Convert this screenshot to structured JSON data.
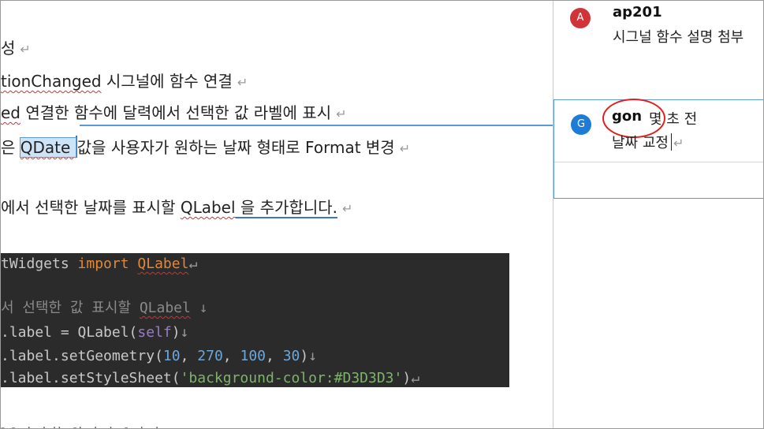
{
  "doc": {
    "line1": "성",
    "line2_code": "tionChanged",
    "line2_rest": " 시그널에 함수 연결",
    "line3_code": "ed",
    "line3_rest": " 연결한 함수에 달력에서 선택한 값 라벨에 표시",
    "line4_pre": "은 ",
    "line4_sel": "QDate ",
    "line4_rest": "값을 사용자가 원하는 날짜 형태로 Format 변경",
    "line5_pre": "에서 선택한 날짜를 표시할 ",
    "line5_code": "QLabel",
    "line5_rest": " 을 추가합니다.",
    "paragraph_mark": "↵",
    "bottom_fragment": "- -  ·  · ··  -·  ·  ·  -  ·  ·"
  },
  "code": {
    "line1_a": "tWidgets ",
    "line1_kw": "import",
    "line1_b": " ",
    "line1_cls": "QLabel",
    "line1_pm": "↵",
    "line2_comment": "서 선택한 값 표시할 ",
    "line2_cls": "QLabel",
    "line2_pm": " ↓",
    "line3_a": ".label = QLabel(",
    "line3_self": "self",
    "line3_b": ")",
    "line3_pm": "↓",
    "line4_a": ".label.setGeometry(",
    "line4_n1": "10",
    "line4_c1": ", ",
    "line4_n2": "270",
    "line4_c2": ", ",
    "line4_n3": "100",
    "line4_c3": ", ",
    "line4_n4": "30",
    "line4_b": ")",
    "line4_pm": "↓",
    "line5_a": ".label.setStyleSheet(",
    "line5_str": "'background-color:#D3D3D3'",
    "line5_b": ")",
    "line5_pm": "↵"
  },
  "comments": [
    {
      "avatar_letter": "A",
      "avatar_color": "#d13438",
      "author": "ap201",
      "body": "시그널 함수 설명 첨부"
    },
    {
      "avatar_letter": "G",
      "avatar_color": "#1e7bd6",
      "author": "gon",
      "time": "몇 초 전",
      "body": "날짜 교정",
      "pm": "↵"
    }
  ]
}
